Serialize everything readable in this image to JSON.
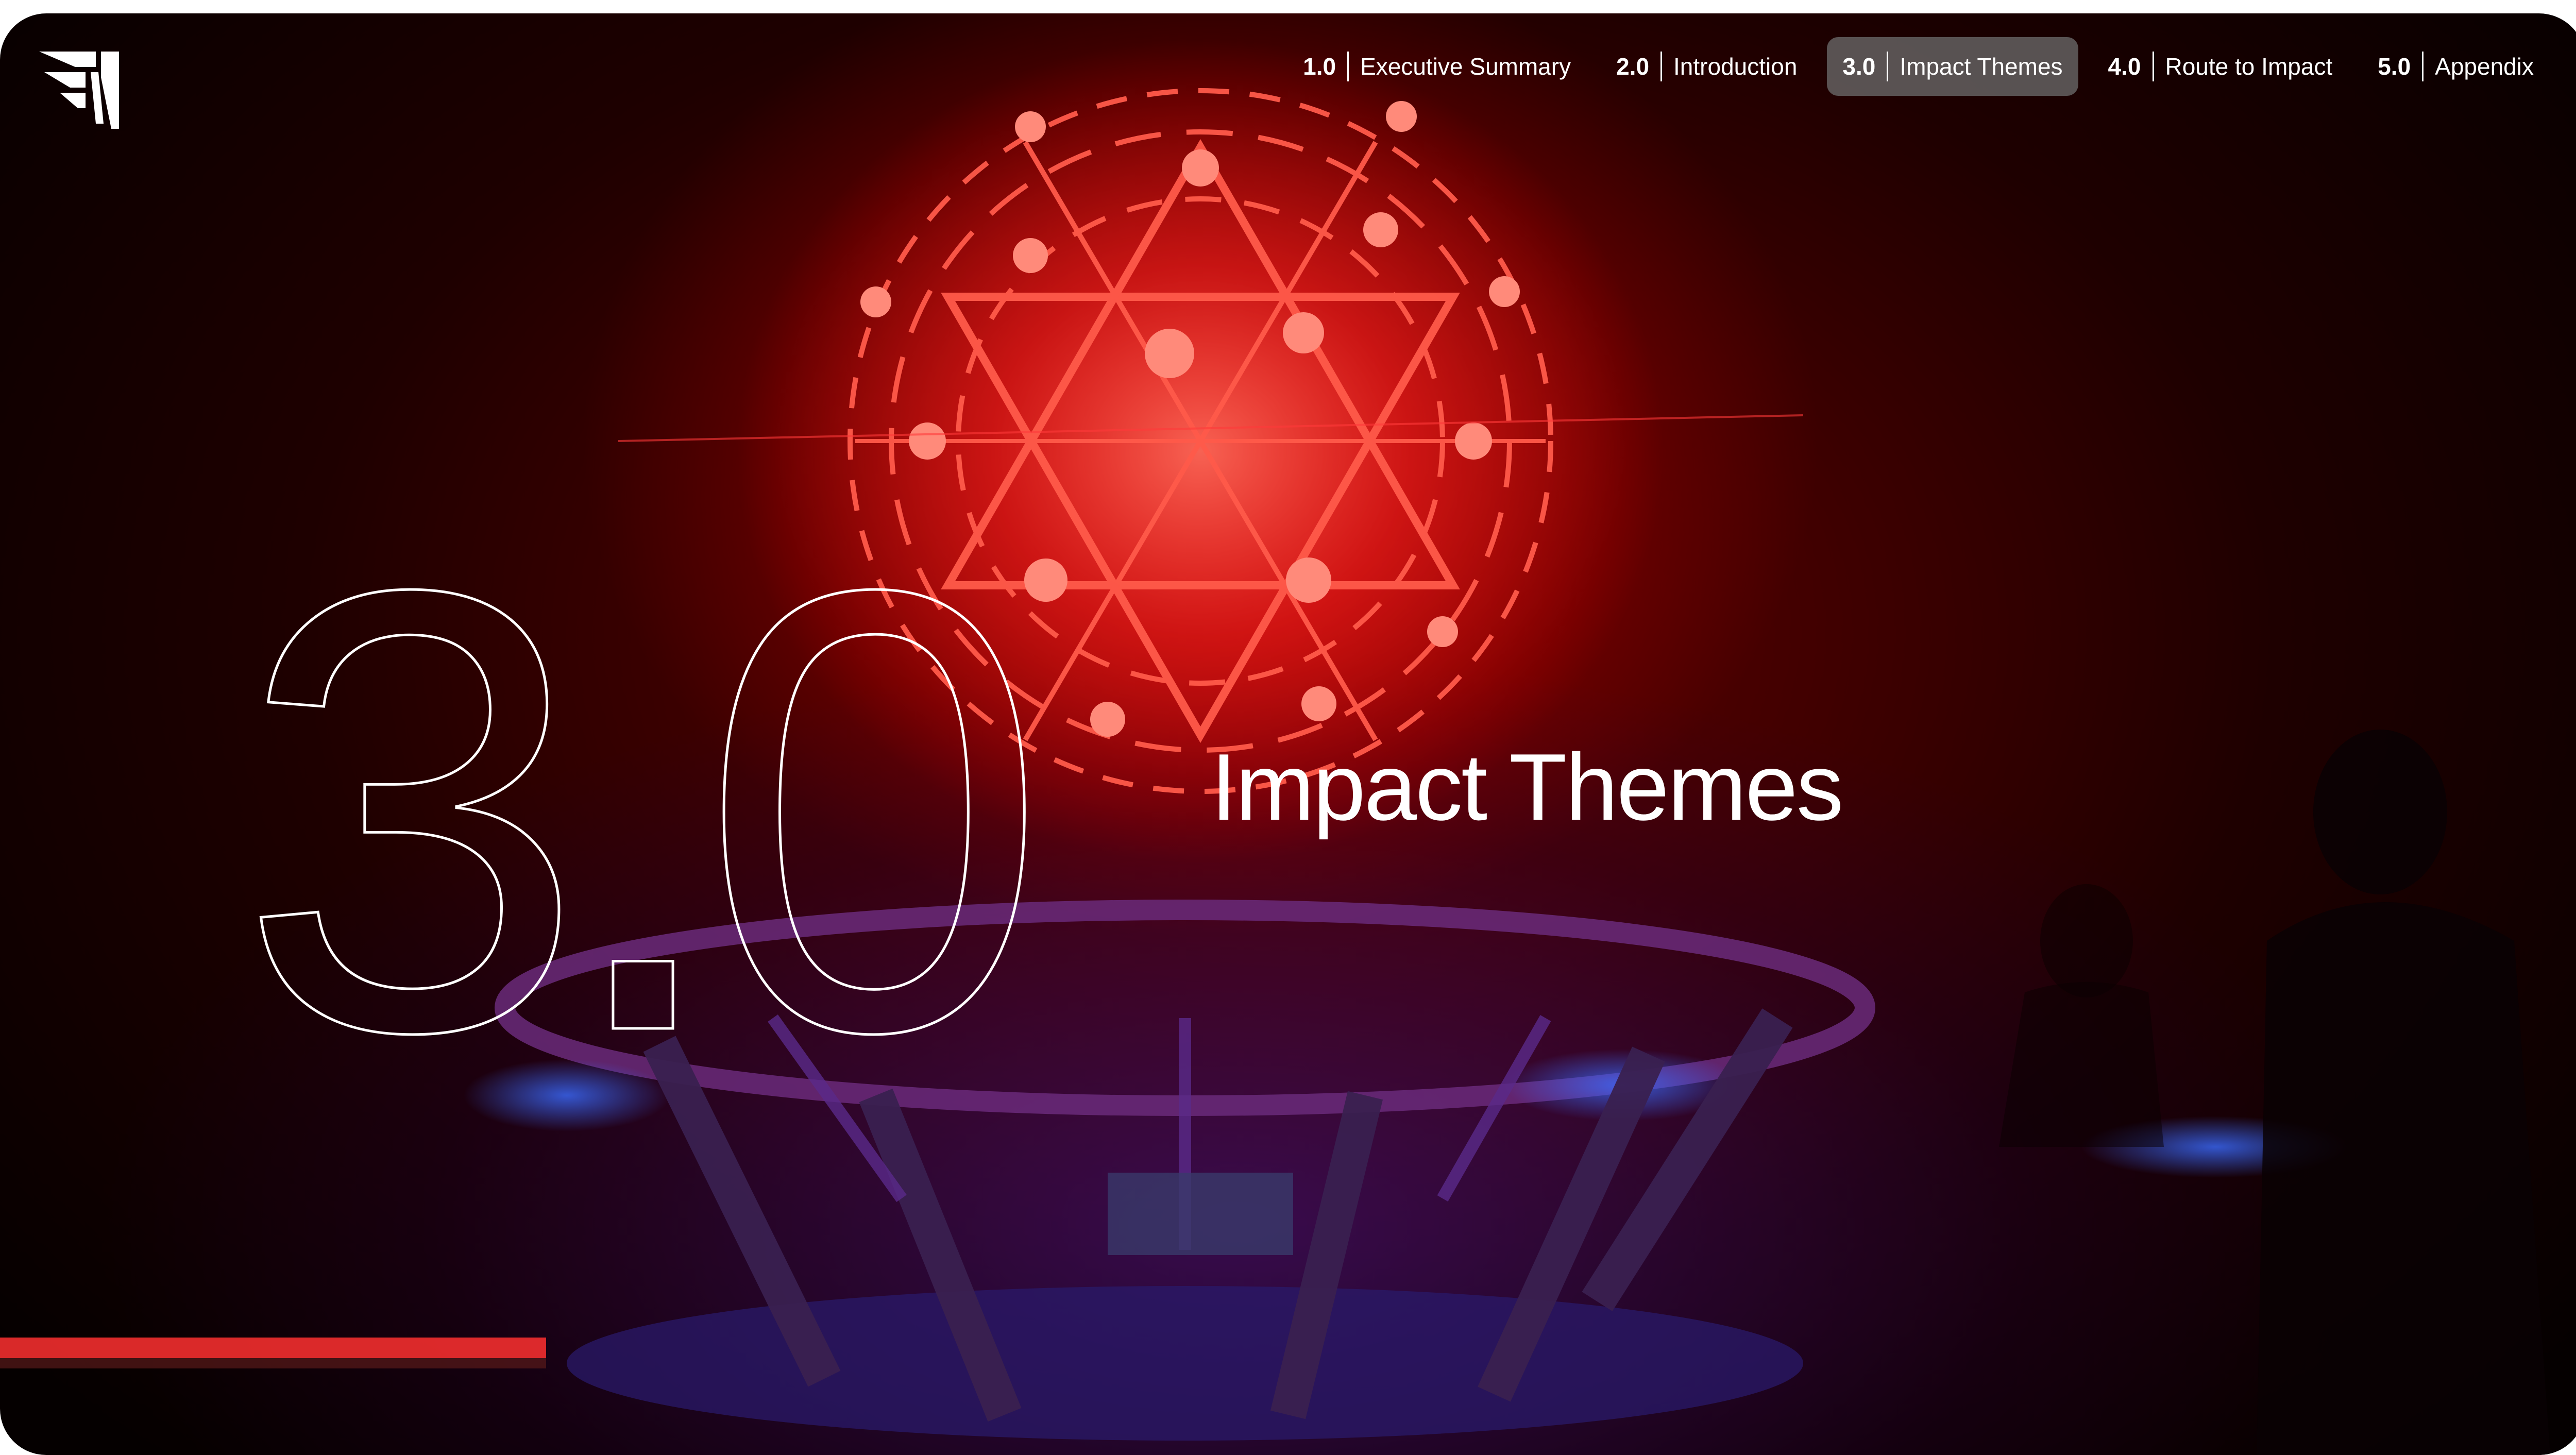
{
  "nav": {
    "items": [
      {
        "num": "1.0",
        "label": "Executive Summary",
        "active": false
      },
      {
        "num": "2.0",
        "label": "Introduction",
        "active": false
      },
      {
        "num": "3.0",
        "label": "Impact Themes",
        "active": true
      },
      {
        "num": "4.0",
        "label": "Route to Impact",
        "active": false
      },
      {
        "num": "5.0",
        "label": "Appendix",
        "active": false
      }
    ]
  },
  "hero": {
    "section_number": "3.0",
    "section_title": "Impact Themes"
  },
  "logo": {
    "icon": "brand-logo-icon"
  },
  "background": {
    "description_icon": "photo-background",
    "accent_color": "#ff2a2a",
    "floor_color": "#3b1a8a"
  }
}
